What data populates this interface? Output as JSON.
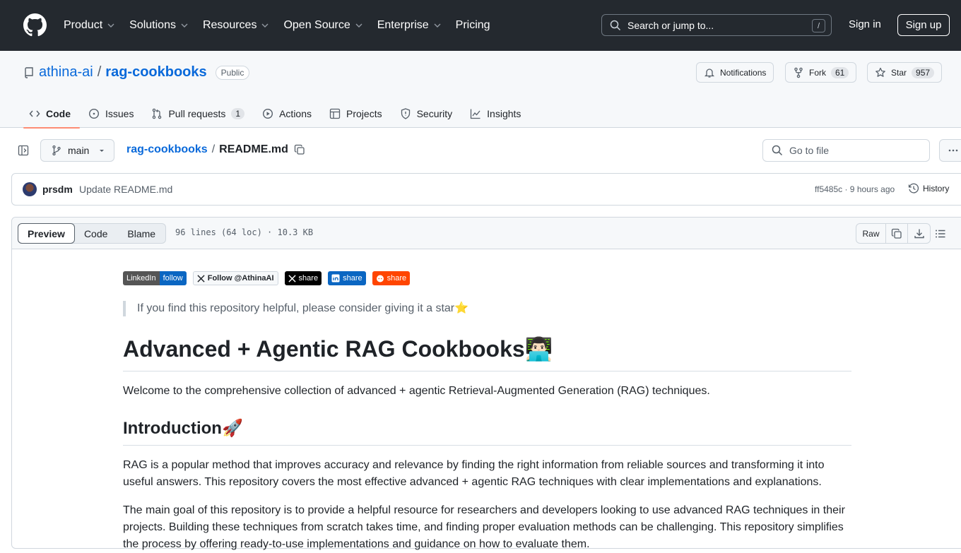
{
  "header": {
    "nav": [
      {
        "label": "Product",
        "has_menu": true
      },
      {
        "label": "Solutions",
        "has_menu": true
      },
      {
        "label": "Resources",
        "has_menu": true
      },
      {
        "label": "Open Source",
        "has_menu": true
      },
      {
        "label": "Enterprise",
        "has_menu": true
      },
      {
        "label": "Pricing",
        "has_menu": false
      }
    ],
    "search_placeholder": "Search or jump to...",
    "search_shortcut": "/",
    "sign_in": "Sign in",
    "sign_up": "Sign up"
  },
  "repo": {
    "owner": "athina-ai",
    "separator": "/",
    "name": "rag-cookbooks",
    "visibility": "Public",
    "notifications_label": "Notifications",
    "fork_label": "Fork",
    "fork_count": "61",
    "star_label": "Star",
    "star_count": "957"
  },
  "tabs": [
    {
      "label": "Code",
      "icon": "code-icon",
      "active": true
    },
    {
      "label": "Issues",
      "icon": "issue-icon"
    },
    {
      "label": "Pull requests",
      "icon": "pull-request-icon",
      "count": "1"
    },
    {
      "label": "Actions",
      "icon": "play-icon"
    },
    {
      "label": "Projects",
      "icon": "table-icon"
    },
    {
      "label": "Security",
      "icon": "shield-icon"
    },
    {
      "label": "Insights",
      "icon": "graph-icon"
    }
  ],
  "file_nav": {
    "branch": "main",
    "breadcrumb_root": "rag-cookbooks",
    "breadcrumb_sep": "/",
    "file_name": "README.md",
    "goto_placeholder": "Go to file"
  },
  "commit": {
    "author": "prsdm",
    "message": "Update README.md",
    "meta": "ff5485c · 9 hours ago",
    "history_label": "History"
  },
  "file_view": {
    "modes": [
      "Preview",
      "Code",
      "Blame"
    ],
    "active_mode": "Preview",
    "info": "96 lines (64 loc) · 10.3 KB",
    "raw_label": "Raw"
  },
  "readme": {
    "badges": [
      {
        "left": "LinkedIn",
        "right": "follow",
        "left_color": "#555555",
        "right_color": "#0a66c2"
      },
      {
        "left": "Follow @AthinaAI",
        "style": "x-follow"
      },
      {
        "left": "share",
        "style": "x-share"
      },
      {
        "left": "share",
        "style": "linkedin-share"
      },
      {
        "left": "share",
        "style": "reddit-share"
      }
    ],
    "quote": "If you find this repository helpful, please consider giving it a star⭐️",
    "title": "Advanced + Agentic RAG Cookbooks👨🏻‍💻",
    "welcome": "Welcome to the comprehensive collection of advanced + agentic Retrieval-Augmented Generation (RAG) techniques.",
    "intro_heading": "Introduction🚀",
    "intro_p1": "RAG is a popular method that improves accuracy and relevance by finding the right information from reliable sources and transforming it into useful answers. This repository covers the most effective advanced + agentic RAG techniques with clear implementations and explanations.",
    "intro_p2": "The main goal of this repository is to provide a helpful resource for researchers and developers looking to use advanced RAG techniques in their projects. Building these techniques from scratch takes time, and finding proper evaluation methods can be challenging. This repository simplifies the process by offering ready-to-use implementations and guidance on how to evaluate them."
  }
}
